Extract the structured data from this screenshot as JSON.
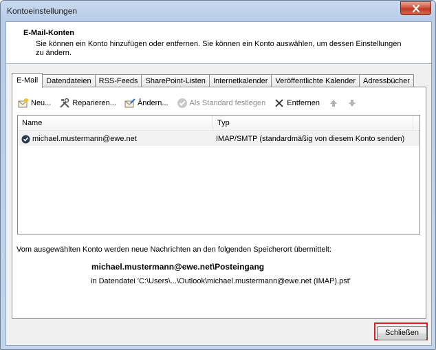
{
  "window": {
    "title": "Kontoeinstellungen",
    "close_glyph": "✕"
  },
  "header": {
    "title": "E-Mail-Konten",
    "description": "Sie können ein Konto hinzufügen oder entfernen. Sie können ein Konto auswählen, um dessen Einstellungen zu ändern."
  },
  "tabs": [
    {
      "label": "E-Mail",
      "active": true
    },
    {
      "label": "Datendateien",
      "active": false
    },
    {
      "label": "RSS-Feeds",
      "active": false
    },
    {
      "label": "SharePoint-Listen",
      "active": false
    },
    {
      "label": "Internetkalender",
      "active": false
    },
    {
      "label": "Veröffentlichte Kalender",
      "active": false
    },
    {
      "label": "Adressbücher",
      "active": false
    }
  ],
  "toolbar": {
    "new_label": "Neu...",
    "repair_label": "Reparieren...",
    "change_label": "Ändern...",
    "set_default_label": "Als Standard festlegen",
    "remove_label": "Entfernen",
    "move_up_icon": "arrow-up-icon",
    "move_down_icon": "arrow-down-icon"
  },
  "accounts_table": {
    "columns": [
      "Name",
      "Typ"
    ],
    "rows": [
      {
        "name": "michael.mustermann@ewe.net",
        "type": "IMAP/SMTP (standardmäßig von diesem Konto senden)"
      }
    ]
  },
  "delivery": {
    "info": "Vom ausgewählten Konto werden neue Nachrichten an den folgenden Speicherort übermittelt:",
    "store_path": "michael.mustermann@ewe.net\\Posteingang",
    "data_file": "in Datendatei 'C:\\Users\\...\\Outlook\\michael.mustermann@ewe.net (IMAP).pst'"
  },
  "footer": {
    "close_button_label": "Schließen"
  },
  "colors": {
    "highlight": "#e01b24",
    "window_frame": "#b9cde8"
  }
}
